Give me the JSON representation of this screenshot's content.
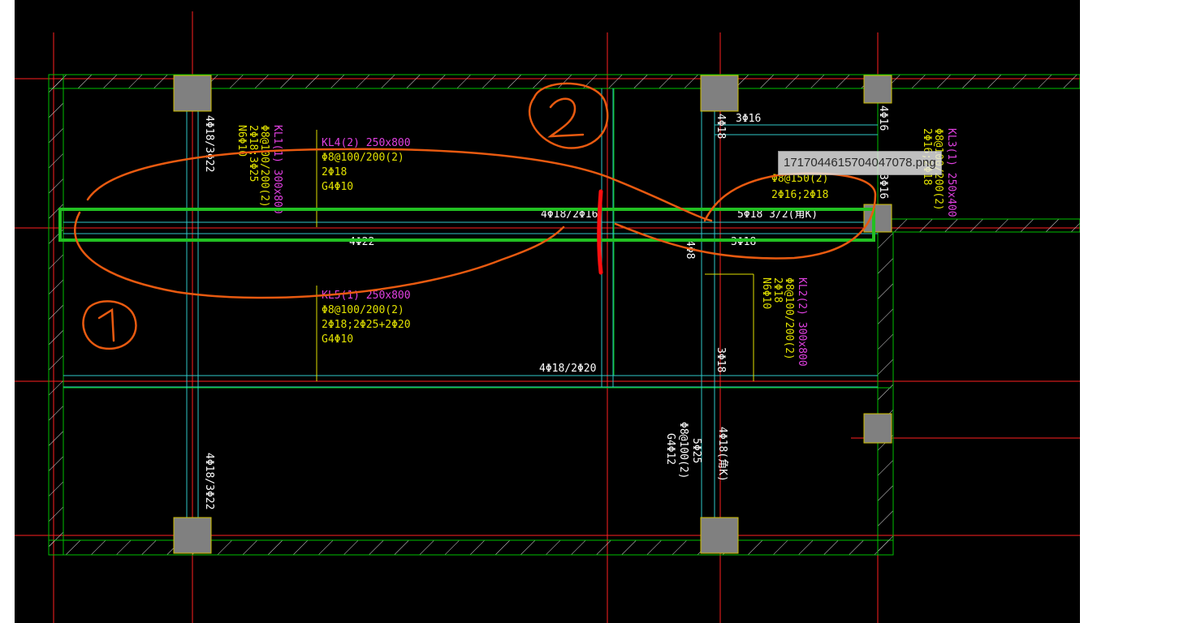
{
  "tooltip": {
    "filename": "1717044615704047078.png"
  },
  "colors": {
    "background": "#000000",
    "wall": "#00c000",
    "axis_red": "#ff2020",
    "beam_cyan": "#30c8c8",
    "label_magenta": "#e040e0",
    "label_yellow": "#e0e000",
    "column_fill": "#808080",
    "markup_orange": "#e85a10",
    "highlight_green": "#22c022"
  },
  "annotations": {
    "kl4_name": "KL4(2) 250x800",
    "kl4_stirrup": "Φ8@100/200(2)",
    "kl4_top": "2Φ18",
    "kl4_side": "G4Φ10",
    "kl5_name": "KL5(1) 250x800",
    "kl5_stirrup": "Φ8@100/200(2)",
    "kl5_top": "2Φ18;2Φ25+2Φ20",
    "kl5_side": "G4Φ10",
    "kl1_name": "KL1(1) 300x800",
    "kl1_stirrup": "Φ8@100/200(2)",
    "kl1_top": "2Φ18;3Φ25",
    "kl1_side": "N6Φ10",
    "kl2_name": "KL2(2) 300x800",
    "kl2_stirrup": "Φ8@100/200(2)",
    "kl2_top": "2Φ18",
    "kl2_side": "N6Φ10",
    "kl3_name": "KL3(1) 250x400",
    "kl3_stirrup": "Φ8@100/200(2)",
    "kl3_top": "2Φ16;2Φ18",
    "l_stirrup": "Φ8@150(2)",
    "l_top": "2Φ16;2Φ18",
    "mid_beam_top": "4Φ18/2Φ16",
    "mid_beam_bottom": "4Φ22",
    "lower_beam_bottom": "4Φ18/2Φ20",
    "right_beam_top": "5Φ18 3/2(角K)",
    "right_beam_bottom": "3Φ18",
    "col_upper_left": "4Φ18/3Φ22",
    "col_lower_left": "4Φ18/3Φ22",
    "col_mid_top": "3Φ16",
    "col_mid_vert": "4Φ18",
    "col_mid_small": "4Φ8",
    "col_mid_lower": "3Φ18",
    "right_vert_top": "4Φ16",
    "right_vert_mid": "3Φ16",
    "bottom_beam_name": "5Φ25",
    "bottom_beam_stirrup": "Φ8@100(2)",
    "bottom_beam_side": "G4Φ12",
    "bottom_vert": "4Φ18(角K)"
  },
  "markup": {
    "circle_1": "1",
    "circle_2": "2"
  }
}
